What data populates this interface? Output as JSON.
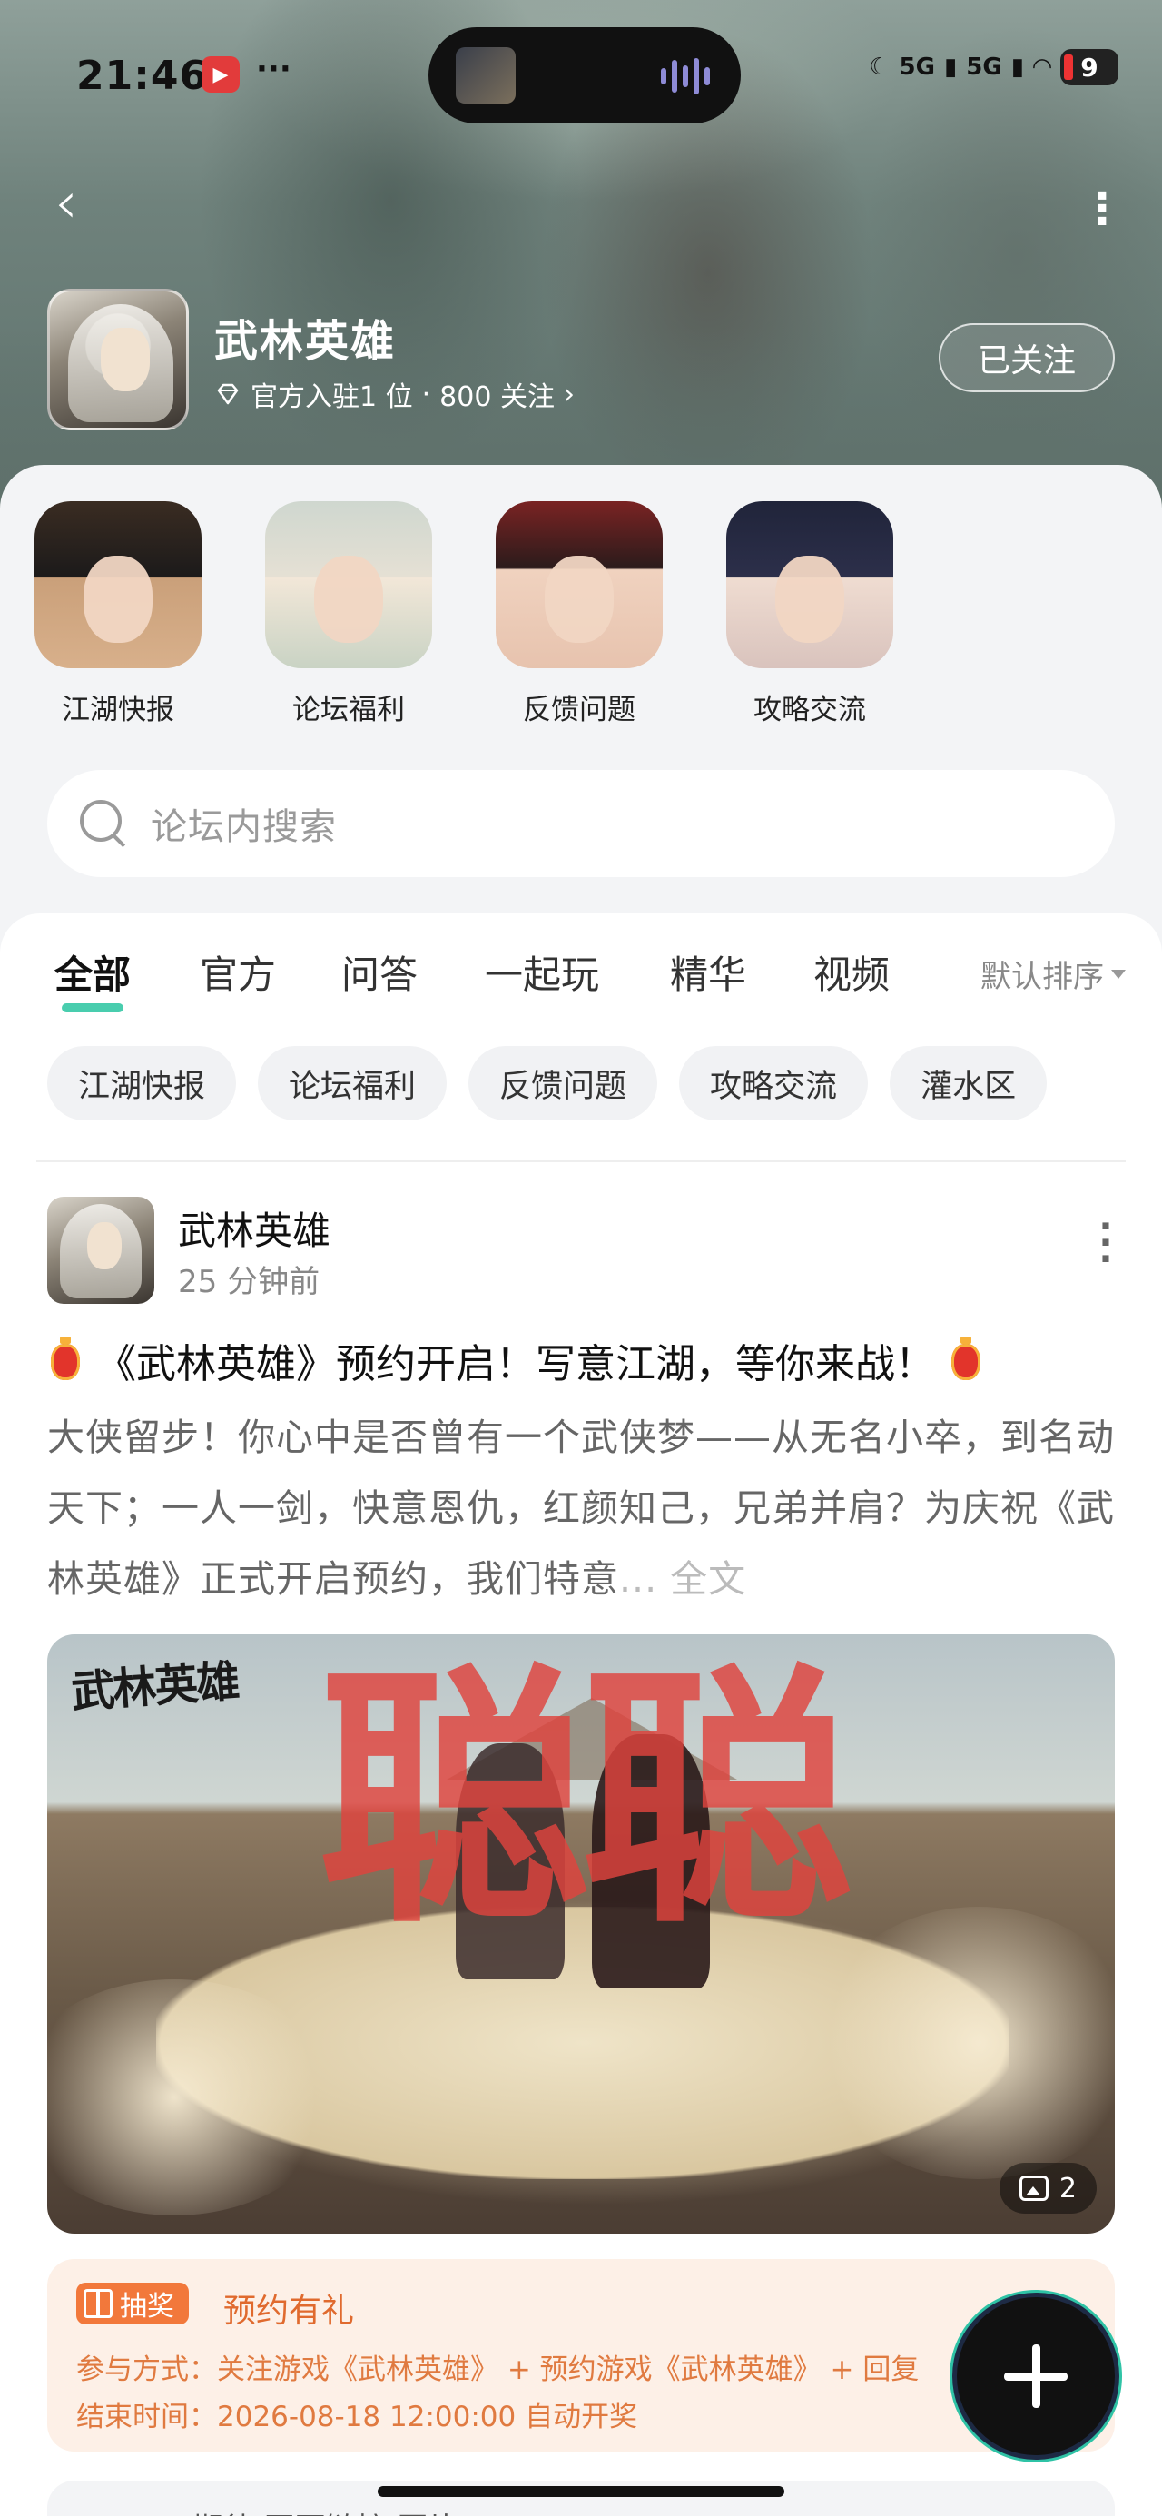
{
  "status_bar": {
    "time": "21:46",
    "app_badge": "▶",
    "more": "···",
    "network_1": "5G",
    "network_2": "5G",
    "battery": "9"
  },
  "header": {
    "forum_name": "武林英雄",
    "meta_official": "官方入驻1 位",
    "meta_separator": "·",
    "meta_followers": "800 关注",
    "meta_arrow": "›",
    "follow_button": "已关注",
    "back_icon": "‹",
    "more_icon": "⋮"
  },
  "quick_links": [
    {
      "label": "江湖快报"
    },
    {
      "label": "论坛福利"
    },
    {
      "label": "反馈问题"
    },
    {
      "label": "攻略交流"
    }
  ],
  "search": {
    "placeholder": "论坛内搜索"
  },
  "tabs": [
    {
      "label": "全部",
      "active": true
    },
    {
      "label": "官方"
    },
    {
      "label": "问答"
    },
    {
      "label": "一起玩"
    },
    {
      "label": "精华"
    },
    {
      "label": "视频"
    }
  ],
  "sort": {
    "label": "默认排序"
  },
  "chips": [
    "江湖快报",
    "论坛福利",
    "反馈问题",
    "攻略交流",
    "灌水区"
  ],
  "post": {
    "author": "武林英雄",
    "time": "25 分钟前",
    "more": "⋮",
    "title": "《武林英雄》预约开启！写意江湖，等你来战！",
    "body": "大侠留步！你心中是否曾有一个武侠梦——从无名小卒，到名动天下；一人一剑，快意恩仇，红颜知己，兄弟并肩？为庆祝《武林英雄》正式开启预约，我们特意",
    "body_more": "... 全文",
    "image_logo": "武林英雄",
    "image_watermark": "聪聪",
    "image_count": "2"
  },
  "lottery": {
    "tag": "抽奖",
    "title": "预约有礼",
    "participation": "参与方式：关注游戏《武林英雄》 + 预约游戏《武林英雄》 + 回复",
    "end_time": "结束时间：2026-08-18 12:00:00 自动开奖"
  },
  "next_post_preview": {
    "text": "期待  网页链接  图片"
  },
  "colors": {
    "accent": "#29c4a0",
    "lottery_orange": "#f2783b",
    "watermark_red": "#e0443e"
  }
}
